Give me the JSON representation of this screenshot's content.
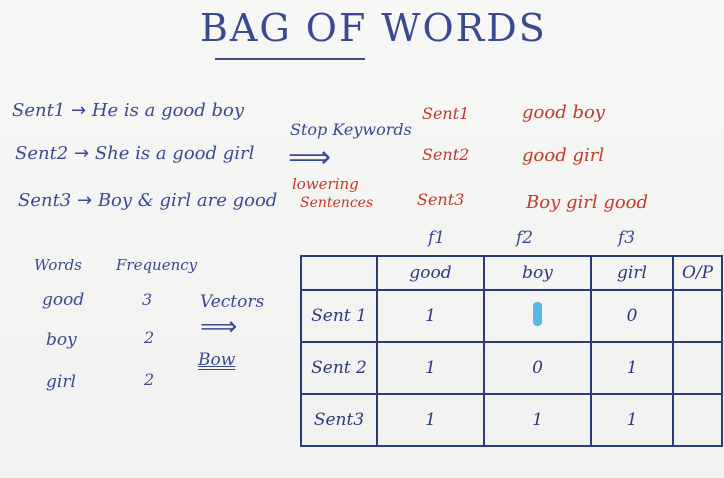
{
  "title": "BAG OF WORDS",
  "sentences": [
    {
      "label": "Sent1",
      "arrow": "→",
      "text": "He is a good boy"
    },
    {
      "label": "Sent2",
      "arrow": "→",
      "text": "She is a good girl"
    },
    {
      "label": "Sent3",
      "arrow": "→",
      "text": "Boy & girl are good"
    }
  ],
  "middle": {
    "stop": "Stop Keywords",
    "arrow": "⟹",
    "lower1": "lowering",
    "lower2": "Sentences"
  },
  "processed": [
    {
      "label": "Sent1",
      "text": "good   boy"
    },
    {
      "label": "Sent2",
      "text": "good   girl"
    },
    {
      "label": "Sent3",
      "text": "Boy   girl   good"
    }
  ],
  "freq": {
    "headers": [
      "Words",
      "Frequency"
    ],
    "rows": [
      [
        "good",
        "3"
      ],
      [
        "boy",
        "2"
      ],
      [
        "girl",
        "2"
      ]
    ]
  },
  "vectors": {
    "label": "Vectors",
    "arrow": "⟹",
    "bow": "Bow"
  },
  "features": [
    "f1",
    "f2",
    "f3"
  ],
  "table": {
    "headers": [
      "",
      "good",
      "boy",
      "girl",
      "O/P"
    ],
    "rows": [
      [
        "Sent 1",
        "1",
        "1",
        "0",
        ""
      ],
      [
        "Sent 2",
        "1",
        "0",
        "1",
        ""
      ],
      [
        "Sent3",
        "1",
        "1",
        "1",
        ""
      ]
    ]
  }
}
